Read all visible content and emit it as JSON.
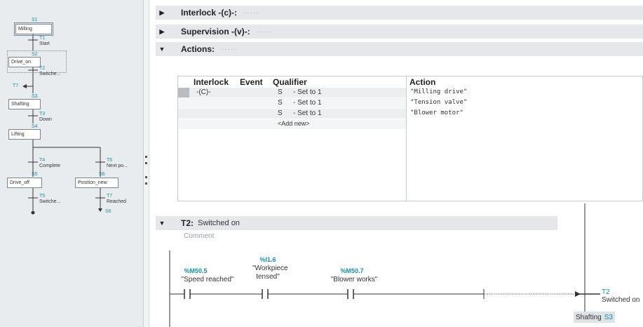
{
  "overview": {
    "steps": [
      {
        "num": "S1",
        "name": "Milling"
      },
      {
        "num": "S2",
        "name": "Drive_on"
      },
      {
        "num": "S3",
        "name": "Shafting"
      },
      {
        "num": "S4",
        "name": "Lifting"
      },
      {
        "num": "S5",
        "name": "Drive_off"
      },
      {
        "num": "S6",
        "name": "Position_new"
      }
    ],
    "transitions": [
      {
        "num": "T1",
        "name": "Start"
      },
      {
        "num": "T2",
        "name": "Switche..."
      },
      {
        "num": "T3",
        "name": "Down"
      },
      {
        "num": "T4",
        "name": "Complete"
      },
      {
        "num": "T5",
        "name": "Switche..."
      },
      {
        "num": "T6",
        "name": "Next po..."
      },
      {
        "num": "T7",
        "name": "Reached"
      }
    ],
    "jump_top": "T7",
    "jump_bottom": "S6"
  },
  "sections": {
    "interlock": "Interlock -(c)-:",
    "supervision": "Supervision -(v)-:",
    "actions": "Actions:"
  },
  "actions_table": {
    "headers": [
      "Interlock",
      "Event",
      "Qualifier",
      "Action"
    ],
    "rows": [
      {
        "interlock": "-(C)-",
        "qualifier": "S",
        "qualifier_desc": "- Set to 1",
        "action": "\"Milling drive\""
      },
      {
        "interlock": "",
        "qualifier": "S",
        "qualifier_desc": "- Set to 1",
        "action": "\"Tension valve\""
      },
      {
        "interlock": "",
        "qualifier": "S",
        "qualifier_desc": "- Set to 1",
        "action": "\"Blower motor\""
      }
    ],
    "add_new": "<Add new>"
  },
  "transition": {
    "name": "T2:",
    "description": "Switched on",
    "comment_placeholder": "Comment",
    "operands": [
      {
        "address": "%M50.5",
        "symbol": "\"Speed reached\""
      },
      {
        "address": "%I1.6",
        "symbol": "\"Workpiece tensed\""
      },
      {
        "address": "%M50.7",
        "symbol": "\"Blower works\""
      }
    ],
    "transition_num": "T2",
    "transition_name": "Switched on",
    "next_step_name": "Shafting",
    "next_step_num": "S3"
  },
  "colors": {
    "accent": "#1a8fa0",
    "header_bg": "#e5e7ea",
    "pane_bg": "#e9ecef"
  }
}
